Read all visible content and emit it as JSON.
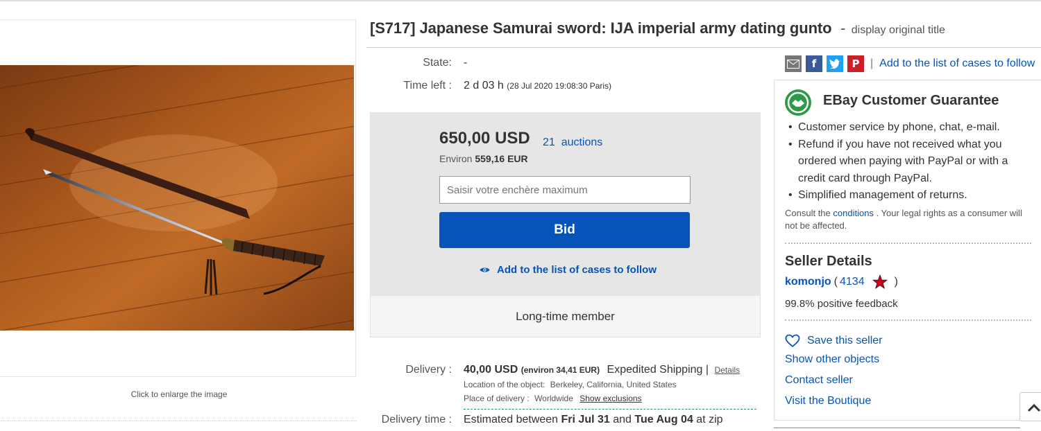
{
  "listing": {
    "title": "[S717] Japanese Samurai sword: IJA imperial army dating gunto",
    "title_dash": "-",
    "original_title_link": "display original title",
    "enlarge_hint": "Click to enlarge the image"
  },
  "details": {
    "state_label": "State:",
    "state_value": "-",
    "time_left_label": "Time left :",
    "time_left_value": "2 d 03 h",
    "time_left_date": "(28 Jul 2020   19:08:30 Paris)"
  },
  "bid": {
    "price": "650,00 USD",
    "auctions_count": "21",
    "auctions_label": "auctions",
    "environ_label": "Environ",
    "environ_value": "559,16 EUR",
    "input_placeholder": "Saisir votre enchère maximum",
    "button_label": "Bid",
    "follow_label": "Add to the list of cases to follow",
    "member_label": "Long-time member"
  },
  "delivery": {
    "label": "Delivery :",
    "price": "40,00 USD",
    "environ": "(environ 34,41 EUR)",
    "method": "Expedited Shipping |",
    "details_link": "Details",
    "location_label": "Location of the object:",
    "location_value": "Berkeley, California, United States",
    "place_label": "Place of delivery :",
    "place_value": "Worldwide",
    "exclusions_link": "Show exclusions",
    "time_label": "Delivery time :",
    "time_prefix": "Estimated between",
    "date_from": "Fri Jul 31",
    "and": "and",
    "date_to": "Tue Aug 04",
    "suffix": "at zip"
  },
  "share": {
    "separator": "|",
    "follow_link": "Add to the list of cases to follow",
    "icons": [
      "email-icon",
      "facebook-icon",
      "twitter-icon",
      "pinterest-icon"
    ],
    "colors": {
      "email": "#777777",
      "facebook": "#3b5998",
      "twitter": "#1da1f2",
      "pinterest": "#cb2027"
    }
  },
  "guarantee": {
    "title": "EBay Customer Guarantee",
    "items": [
      "Customer service by phone, chat, e-mail.",
      "Refund if you have not received what you ordered when paying with PayPal or with a credit card through PayPal.",
      "Simplified management of returns."
    ],
    "consult_prefix": "Consult the",
    "conditions_link": "conditions",
    "consult_suffix": ". Your legal rights as a consumer will not be affected."
  },
  "seller": {
    "heading": "Seller Details",
    "name": "komonjo",
    "open_paren": "(",
    "score": "4134",
    "close_paren": ")",
    "feedback": "99.8% positive feedback",
    "save_link": "Save this seller",
    "other_objects_link": "Show other objects",
    "contact_link": "Contact seller",
    "boutique_link": "Visit the Boutique"
  },
  "colors": {
    "link": "#0654ba",
    "bid_button": "#0654ba",
    "bid_box_bg": "#e6e6e6",
    "guarantee_green": "#2e9a47",
    "star_red": "#d0021b"
  }
}
